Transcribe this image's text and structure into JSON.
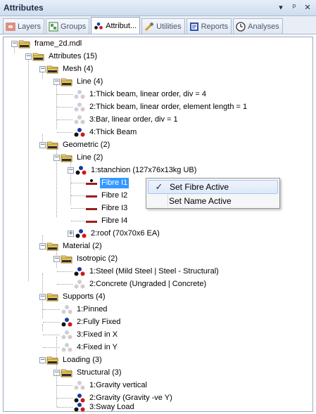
{
  "window": {
    "title": "Attributes",
    "controls": [
      "▾",
      "ᵖ",
      "✕"
    ]
  },
  "tabs": [
    {
      "label": "Layers",
      "icon": "layers-icon",
      "active": false
    },
    {
      "label": "Groups",
      "icon": "groups-icon",
      "active": false
    },
    {
      "label": "Attribut...",
      "icon": "attributes-icon",
      "active": true
    },
    {
      "label": "Utilities",
      "icon": "utilities-icon",
      "active": false
    },
    {
      "label": "Reports",
      "icon": "reports-icon",
      "active": false
    },
    {
      "label": "Analyses",
      "icon": "analyses-icon",
      "active": false
    }
  ],
  "tree": {
    "root": "frame_2d.mdl",
    "attributes": "Attributes (15)",
    "mesh": "Mesh (4)",
    "mesh_line": "Line (4)",
    "mesh_items": [
      "1:Thick beam, linear order, div = 4",
      "2:Thick beam, linear order, element length = 1",
      "3:Bar, linear order, div = 1",
      "4:Thick Beam"
    ],
    "geometric": "Geometric (2)",
    "geo_line": "Line (2)",
    "stanchion": "1:stanchion (127x76x13kg UB)",
    "fibres": [
      "Fibre I1",
      "Fibre I2",
      "Fibre I3",
      "Fibre I4"
    ],
    "roof": "2:roof (70x70x6 EA)",
    "material": "Material (2)",
    "isotropic": "Isotropic (2)",
    "material_items": [
      "1:Steel (Mild Steel | Steel - Structural)",
      "2:Concrete (Ungraded | Concrete)"
    ],
    "supports": "Supports (4)",
    "support_items": [
      "1:Pinned",
      "2:Fully Fixed",
      "3:Fixed in X",
      "4:Fixed in Y"
    ],
    "loading": "Loading (3)",
    "structural": "Structural (3)",
    "loading_items": [
      "1:Gravity vertical",
      "2:Gravity (Gravity -ve Y)",
      "3:Sway Load"
    ]
  },
  "context_menu": {
    "items": [
      {
        "label": "Set Fibre Active",
        "checked": true
      },
      {
        "label": "Set Name Active",
        "checked": false
      }
    ],
    "check_glyph": "✓"
  },
  "colors": {
    "selection": "#3399ff",
    "folder": "#e8c65a",
    "fibre": "#9a1c1c"
  }
}
